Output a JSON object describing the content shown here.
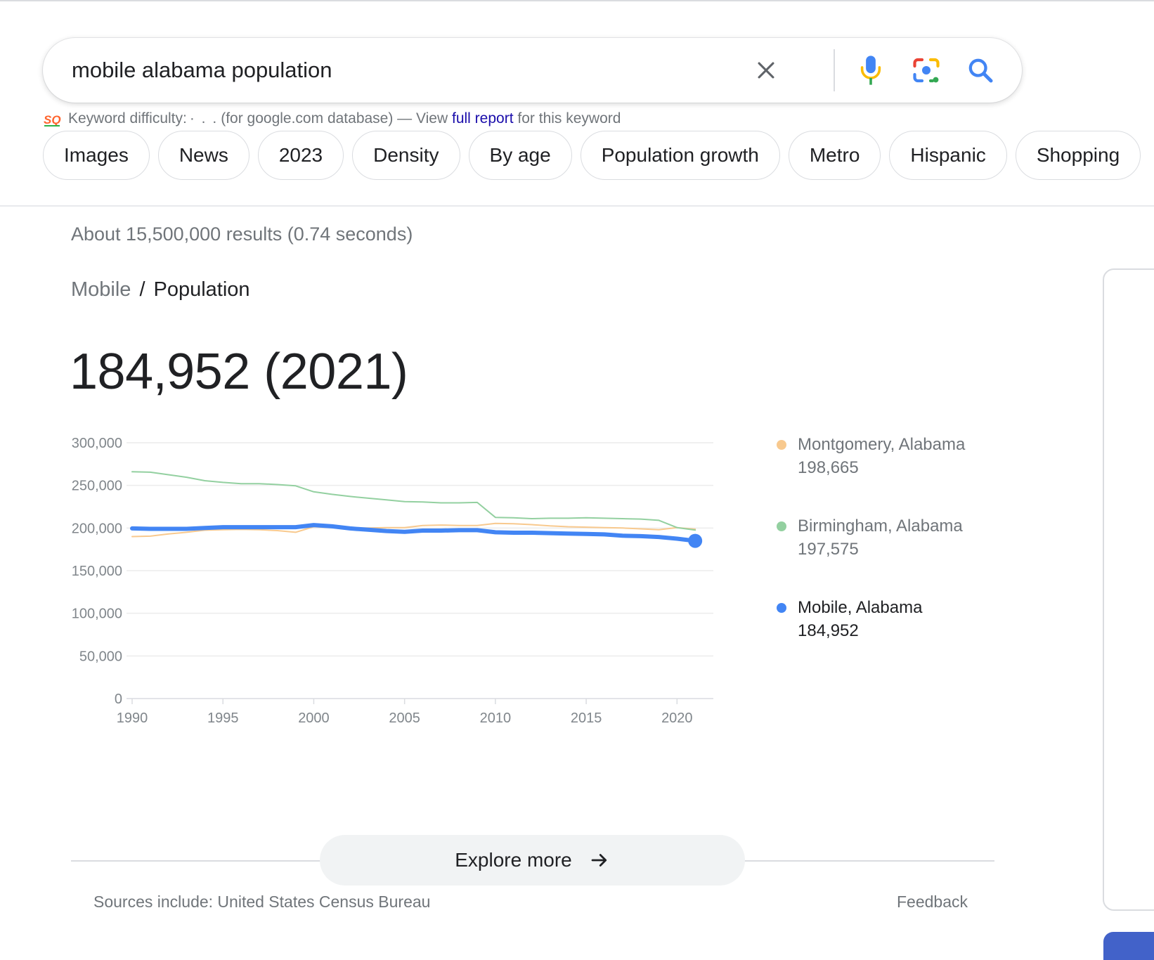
{
  "search": {
    "query": "mobile alabama population",
    "placeholder": ""
  },
  "icons": {
    "clear": "close-icon",
    "voice": "microphone-icon",
    "lens": "camera-lens-icon",
    "search": "search-icon",
    "semrush": "semrush-logo-icon",
    "arrow": "arrow-right-icon"
  },
  "keyword_bar": {
    "prefix": "Keyword difficulty:",
    "dots": "· . .",
    "database": "(for google.com database) — View",
    "link": "full report",
    "suffix": "for this keyword"
  },
  "chips": [
    "Images",
    "News",
    "2023",
    "Density",
    "By age",
    "Population growth",
    "Metro",
    "Hispanic",
    "Shopping"
  ],
  "results_stats": "About 15,500,000 results (0.74 seconds)",
  "breadcrumb": {
    "parent": "Mobile",
    "separator": "/",
    "current": "Population"
  },
  "headline_value": "184,952 (2021)",
  "chart_data": {
    "type": "line",
    "title": "",
    "xlabel": "",
    "ylabel": "",
    "x": [
      1990,
      1991,
      1992,
      1993,
      1994,
      1995,
      1996,
      1997,
      1998,
      1999,
      2000,
      2001,
      2002,
      2003,
      2004,
      2005,
      2006,
      2007,
      2008,
      2009,
      2010,
      2011,
      2012,
      2013,
      2014,
      2015,
      2016,
      2017,
      2018,
      2019,
      2020,
      2021
    ],
    "xticks": [
      1990,
      1995,
      2000,
      2005,
      2010,
      2015,
      2020
    ],
    "xtick_labels": [
      "1990",
      "1995",
      "2000",
      "2005",
      "2010",
      "2015",
      "2020"
    ],
    "ylim": [
      0,
      300000
    ],
    "yticks": [
      0,
      50000,
      100000,
      150000,
      200000,
      250000,
      300000
    ],
    "ytick_labels": [
      "0",
      "50,000",
      "100,000",
      "150,000",
      "200,000",
      "250,000",
      "300,000"
    ],
    "grid": true,
    "legend_position": "right",
    "series": [
      {
        "name": "Montgomery, Alabama",
        "color": "#f8c98e",
        "values": [
          190000,
          190500,
          193000,
          195000,
          197500,
          198000,
          198500,
          198000,
          197000,
          195000,
          201500,
          200500,
          200000,
          200000,
          200500,
          200500,
          203000,
          203500,
          203000,
          203000,
          205500,
          205000,
          204000,
          202500,
          201500,
          201000,
          200500,
          200000,
          199000,
          198000,
          200500,
          198665
        ]
      },
      {
        "name": "Birmingham, Alabama",
        "color": "#93d0a0",
        "values": [
          266000,
          265500,
          262500,
          259500,
          255500,
          253500,
          252000,
          252000,
          251000,
          249500,
          242500,
          239500,
          237000,
          235000,
          233000,
          231000,
          230500,
          229500,
          229500,
          230000,
          212500,
          212000,
          211000,
          211500,
          211500,
          212000,
          211500,
          211000,
          210500,
          209000,
          200500,
          197575
        ]
      },
      {
        "name": "Mobile, Alabama",
        "color": "#4285f4",
        "values": [
          199500,
          199000,
          199000,
          199000,
          200000,
          201000,
          201000,
          201000,
          201000,
          201000,
          203500,
          202000,
          199500,
          198000,
          196500,
          195500,
          197000,
          197000,
          197500,
          197500,
          195000,
          194500,
          194500,
          194000,
          193500,
          193000,
          192500,
          191000,
          190500,
          189500,
          187500,
          184952
        ]
      }
    ]
  },
  "legend": [
    {
      "name": "Montgomery, Alabama",
      "value": "198,665",
      "color": "#f8c98e"
    },
    {
      "name": "Birmingham, Alabama",
      "value": "197,575",
      "color": "#93d0a0"
    },
    {
      "name": "Mobile, Alabama",
      "value": "184,952",
      "color": "#4285f4"
    }
  ],
  "explore_more": "Explore more",
  "sources": "Sources include: United States Census Bureau",
  "feedback": "Feedback"
}
